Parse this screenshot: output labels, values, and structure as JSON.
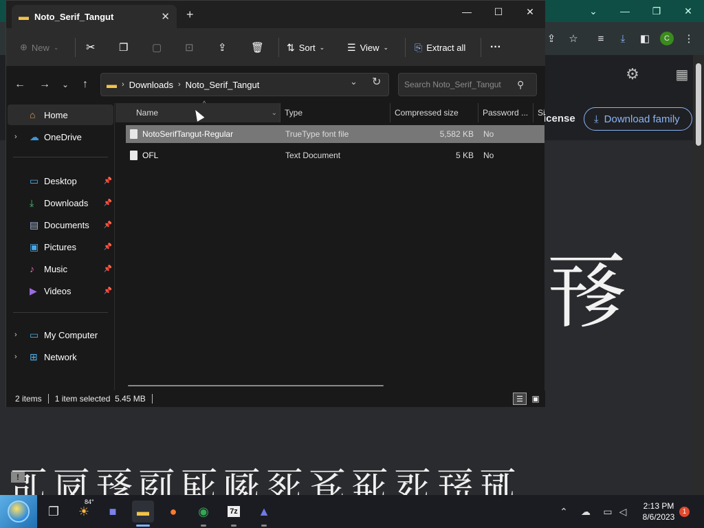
{
  "browser": {
    "license_label": "icense",
    "download_family_label": "Download family",
    "big_glyph": "𗀂",
    "glyph_row": "𗀀𗀁𗀂𗀃𗀄𗀅𗀆𗀇𗀈𗀉𗀊𗀋",
    "profile_initial": "C"
  },
  "explorer": {
    "tab_title": "Noto_Serif_Tangut",
    "commands": {
      "new_label": "New",
      "sort_label": "Sort",
      "view_label": "View",
      "extract_all_label": "Extract all"
    },
    "address": {
      "crumbs": [
        "Downloads",
        "Noto_Serif_Tangut"
      ]
    },
    "search": {
      "placeholder": "Search Noto_Serif_Tangut"
    },
    "nav": {
      "home": "Home",
      "onedrive": "OneDrive",
      "desktop": "Desktop",
      "downloads": "Downloads",
      "documents": "Documents",
      "pictures": "Pictures",
      "music": "Music",
      "videos": "Videos",
      "my_computer": "My Computer",
      "network": "Network"
    },
    "columns": {
      "name": "Name",
      "type": "Type",
      "compressed_size": "Compressed size",
      "password": "Password ...",
      "size": "Si"
    },
    "files": [
      {
        "name": "NotoSerifTangut-Regular",
        "type": "TrueType font file",
        "compressed_size": "5,582 KB",
        "password": "No"
      },
      {
        "name": "OFL",
        "type": "Text Document",
        "compressed_size": "5 KB",
        "password": "No"
      }
    ],
    "status": {
      "item_count": "2 items",
      "selection": "1 item selected  5.45 MB"
    }
  },
  "taskbar": {
    "weather_temp": "84°",
    "time": "2:13 PM",
    "date": "8/6/2023",
    "notification_count": "1"
  },
  "colors": {
    "browser_title": "#0f4e45",
    "accent_link": "#8ab4f8",
    "selection": "#777777",
    "notification": "#e3492e"
  }
}
